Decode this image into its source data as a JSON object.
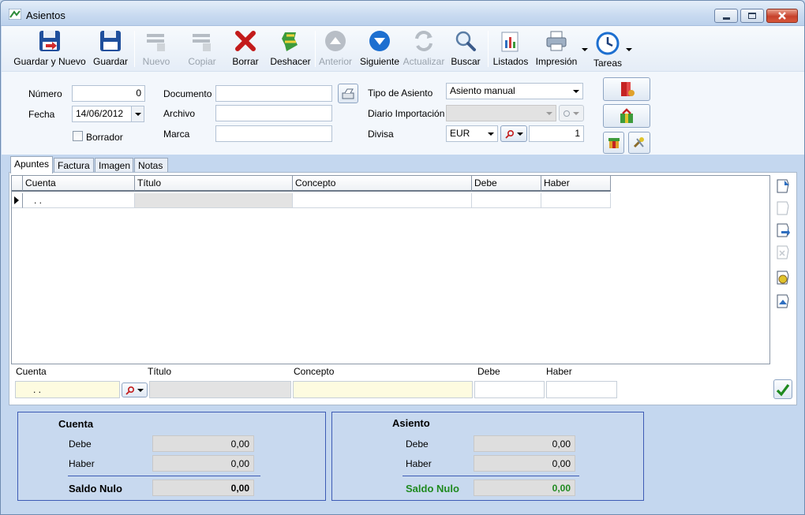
{
  "window": {
    "title": "Asientos",
    "minimize_icon": "minimize-icon",
    "maximize_icon": "maximize-icon",
    "close_icon": "close-icon"
  },
  "toolbar": {
    "items": [
      {
        "label": "Guardar y Nuevo",
        "icon": "save-new-icon",
        "enabled": true
      },
      {
        "label": "Guardar",
        "icon": "save-icon",
        "enabled": true
      },
      {
        "label": "Nuevo",
        "icon": "new-icon",
        "enabled": false
      },
      {
        "label": "Copiar",
        "icon": "copy-icon",
        "enabled": false
      },
      {
        "label": "Borrar",
        "icon": "delete-x-icon",
        "enabled": true
      },
      {
        "label": "Deshacer",
        "icon": "undo-icon",
        "enabled": true
      },
      {
        "label": "Anterior",
        "icon": "up-arrow-icon",
        "enabled": false
      },
      {
        "label": "Siguiente",
        "icon": "down-arrow-icon",
        "enabled": true
      },
      {
        "label": "Actualizar",
        "icon": "refresh-icon",
        "enabled": false
      },
      {
        "label": "Buscar",
        "icon": "search-icon",
        "enabled": true
      },
      {
        "label": "Listados",
        "icon": "report-icon",
        "enabled": true
      },
      {
        "label": "Impresión",
        "icon": "printer-icon",
        "enabled": true
      },
      {
        "label": "Tareas",
        "icon": "clock-icon",
        "enabled": true
      }
    ]
  },
  "form": {
    "numero_label": "Número",
    "numero_value": "0",
    "fecha_label": "Fecha",
    "fecha_value": "14/06/2012",
    "borrador_label": "Borrador",
    "documento_label": "Documento",
    "documento_value": "",
    "archivo_label": "Archivo",
    "archivo_value": "",
    "marca_label": "Marca",
    "marca_value": "",
    "tipo_label": "Tipo de Asiento",
    "tipo_value": "Asiento manual",
    "diario_label": "Diario Importación",
    "diario_value": "",
    "divisa_label": "Divisa",
    "divisa_value": "EUR",
    "cambio_value": "1"
  },
  "tabs": [
    "Apuntes",
    "Factura",
    "Imagen",
    "Notas"
  ],
  "grid": {
    "columns": [
      "Cuenta",
      "Título",
      "Concepto",
      "Debe",
      "Haber"
    ],
    "rows": [
      {
        "cuenta": ". .",
        "titulo": "",
        "concepto": "",
        "debe": "",
        "haber": ""
      }
    ]
  },
  "entry": {
    "cuenta_label": "Cuenta",
    "cuenta_value": ". .",
    "titulo_label": "Título",
    "titulo_value": "",
    "concepto_label": "Concepto",
    "concepto_value": "",
    "debe_label": "Debe",
    "debe_value": "",
    "haber_label": "Haber",
    "haber_value": ""
  },
  "summary": {
    "cuenta": {
      "title": "Cuenta",
      "debe_label": "Debe",
      "debe": "0,00",
      "haber_label": "Haber",
      "haber": "0,00",
      "saldo_label": "Saldo Nulo",
      "saldo": "0,00",
      "saldo_color": "#000000"
    },
    "asiento": {
      "title": "Asiento",
      "debe_label": "Debe",
      "debe": "0,00",
      "haber_label": "Haber",
      "haber": "0,00",
      "saldo_label": "Saldo Nulo",
      "saldo": "0,00",
      "saldo_color": "#1f8a1f"
    }
  }
}
